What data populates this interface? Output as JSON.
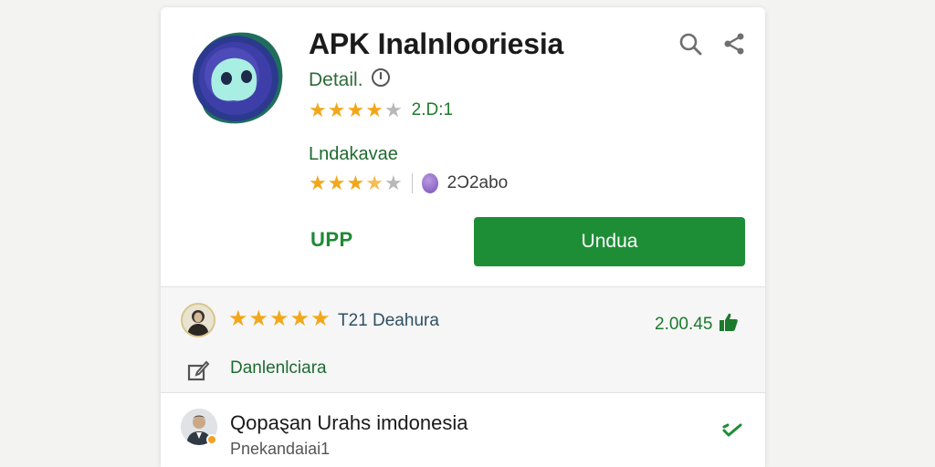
{
  "app": {
    "title": "APK Inalnlooriesia",
    "detail_label": "Detail.",
    "rating_value": "2.D:1",
    "rating_stars": 4,
    "subtitle": "Lndakavae",
    "secondary_rating_stars": 3.5,
    "secondary_count": "2Ɔ2abo",
    "upp_label": "UPP",
    "download_label": "Undua",
    "brand_green": "#1e8e36",
    "star_color": "#f2a71b"
  },
  "review": {
    "stars": 5,
    "text": "T21 Deahura",
    "likes": "2.00.45",
    "edit_label": "Danlenlciara"
  },
  "list_item": {
    "title": "Qopaȿan Urahs imdonesia",
    "subtitle": "Pnekandaiai1"
  },
  "icons": {
    "search": "search-icon",
    "share": "share-icon",
    "info": "info-icon",
    "thumbs_up": "thumbs-up-icon",
    "edit": "edit-icon",
    "action": "chevron-icon"
  }
}
